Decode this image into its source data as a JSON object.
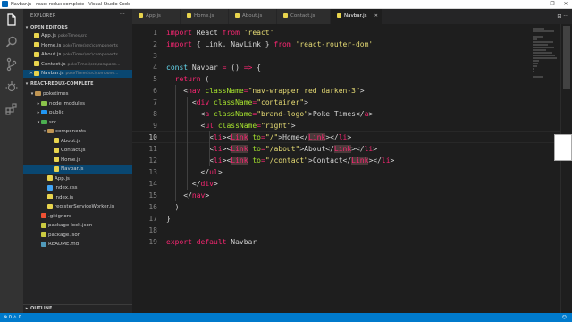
{
  "window": {
    "title": "Navbar.js - react-redux-complete - Visual Studio Code",
    "controls": [
      "—",
      "❐",
      "✕"
    ]
  },
  "activity_bar": {
    "icons": [
      "files-icon",
      "search-icon",
      "source-control-icon",
      "debug-icon",
      "extensions-icon"
    ]
  },
  "sidebar": {
    "header": "EXPLORER",
    "open_editors_label": "OPEN EDITORS",
    "open_editors": [
      {
        "name": "App.js",
        "path": "pokeTimes\\src"
      },
      {
        "name": "Home.js",
        "path": "pokeTimes\\src\\components"
      },
      {
        "name": "About.js",
        "path": "pokeTimes\\src\\components"
      },
      {
        "name": "Contact.js",
        "path": "pokeTimes\\src\\compone..."
      },
      {
        "name": "Navbar.js",
        "path": "pokeTimes\\src\\compone..."
      }
    ],
    "project_label": "REACT-REDUX-COMPLETE",
    "tree": [
      {
        "name": "poketimes",
        "kind": "folder-open"
      },
      {
        "name": "node_modules",
        "kind": "folder"
      },
      {
        "name": "public",
        "kind": "folder"
      },
      {
        "name": "src",
        "kind": "folder-open"
      },
      {
        "name": "components",
        "kind": "folder-open"
      },
      {
        "name": "About.js",
        "kind": "js"
      },
      {
        "name": "Contact.js",
        "kind": "js"
      },
      {
        "name": "Home.js",
        "kind": "js"
      },
      {
        "name": "Navbar.js",
        "kind": "js"
      },
      {
        "name": "App.js",
        "kind": "js"
      },
      {
        "name": "index.css",
        "kind": "css"
      },
      {
        "name": "index.js",
        "kind": "js"
      },
      {
        "name": "registerServiceWorker.js",
        "kind": "js"
      },
      {
        "name": ".gitignore",
        "kind": "git"
      },
      {
        "name": "package-lock.json",
        "kind": "json"
      },
      {
        "name": "package.json",
        "kind": "json"
      },
      {
        "name": "README.md",
        "kind": "md"
      }
    ],
    "outline_label": "OUTLINE"
  },
  "tabs": [
    {
      "label": "App.js",
      "active": false
    },
    {
      "label": "Home.js",
      "active": false
    },
    {
      "label": "About.js",
      "active": false
    },
    {
      "label": "Contact.js",
      "active": false
    },
    {
      "label": "Navbar.js",
      "active": true
    }
  ],
  "tab_actions": "⊟ ···",
  "editor": {
    "current_line": 10,
    "lines": [
      {
        "n": "1",
        "tokens": [
          [
            "k",
            "import"
          ],
          [
            "p",
            " React "
          ],
          [
            "k",
            "from"
          ],
          [
            "p",
            " "
          ],
          [
            "s",
            "'react'"
          ]
        ]
      },
      {
        "n": "2",
        "tokens": [
          [
            "k",
            "import"
          ],
          [
            "p",
            " { Link, NavLink } "
          ],
          [
            "k",
            "from"
          ],
          [
            "p",
            " "
          ],
          [
            "s",
            "'react-router-dom'"
          ]
        ]
      },
      {
        "n": "3",
        "tokens": []
      },
      {
        "n": "4",
        "tokens": [
          [
            "bl",
            "const"
          ],
          [
            "p",
            " Navbar "
          ],
          [
            "k",
            "="
          ],
          [
            "p",
            " () "
          ],
          [
            "k",
            "=>"
          ],
          [
            "p",
            " {"
          ]
        ]
      },
      {
        "n": "5",
        "tokens": [
          [
            "p",
            "  "
          ],
          [
            "k",
            "return"
          ],
          [
            "p",
            " ("
          ]
        ]
      },
      {
        "n": "6",
        "tokens": [
          [
            "p",
            "    <"
          ],
          [
            "t",
            "nav"
          ],
          [
            "p",
            " "
          ],
          [
            "a",
            "className"
          ],
          [
            "k",
            "="
          ],
          [
            "s",
            "\"nav-wrapper red darken-3\""
          ],
          [
            "p",
            ">"
          ]
        ]
      },
      {
        "n": "7",
        "tokens": [
          [
            "p",
            "      <"
          ],
          [
            "t",
            "div"
          ],
          [
            "p",
            " "
          ],
          [
            "a",
            "className"
          ],
          [
            "k",
            "="
          ],
          [
            "s",
            "\"container\""
          ],
          [
            "p",
            ">"
          ]
        ]
      },
      {
        "n": "8",
        "tokens": [
          [
            "p",
            "        <"
          ],
          [
            "t",
            "a"
          ],
          [
            "p",
            " "
          ],
          [
            "a",
            "className"
          ],
          [
            "k",
            "="
          ],
          [
            "s",
            "\"brand-logo\""
          ],
          [
            "p",
            ">Poke'Times</"
          ],
          [
            "t",
            "a"
          ],
          [
            "p",
            ">"
          ]
        ]
      },
      {
        "n": "9",
        "tokens": [
          [
            "p",
            "        <"
          ],
          [
            "t",
            "ul"
          ],
          [
            "p",
            " "
          ],
          [
            "a",
            "className"
          ],
          [
            "k",
            "="
          ],
          [
            "s",
            "\"right\""
          ],
          [
            "p",
            ">"
          ]
        ]
      },
      {
        "n": "10",
        "tokens": [
          [
            "p",
            "          <"
          ],
          [
            "t",
            "li"
          ],
          [
            "p",
            "><"
          ],
          [
            "t",
            "Link"
          ],
          [
            "p",
            " "
          ],
          [
            "a",
            "to"
          ],
          [
            "k",
            "="
          ],
          [
            "s",
            "\"/\""
          ],
          [
            "p",
            ">Home</"
          ],
          [
            "t",
            "Link"
          ],
          [
            "p",
            "></"
          ],
          [
            "t",
            "li"
          ],
          [
            "p",
            ">"
          ]
        ]
      },
      {
        "n": "11",
        "tokens": [
          [
            "p",
            "          <"
          ],
          [
            "t",
            "li"
          ],
          [
            "p",
            "><"
          ],
          [
            "t",
            "Link"
          ],
          [
            "p",
            " "
          ],
          [
            "a",
            "to"
          ],
          [
            "k",
            "="
          ],
          [
            "s",
            "\"/about\""
          ],
          [
            "p",
            ">About</"
          ],
          [
            "t",
            "Link"
          ],
          [
            "p",
            "></"
          ],
          [
            "t",
            "li"
          ],
          [
            "p",
            ">"
          ]
        ]
      },
      {
        "n": "12",
        "tokens": [
          [
            "p",
            "          <"
          ],
          [
            "t",
            "li"
          ],
          [
            "p",
            "><"
          ],
          [
            "t",
            "Link"
          ],
          [
            "p",
            " "
          ],
          [
            "a",
            "to"
          ],
          [
            "k",
            "="
          ],
          [
            "s",
            "\"/contact\""
          ],
          [
            "p",
            ">Contact</"
          ],
          [
            "t",
            "Link"
          ],
          [
            "p",
            "></"
          ],
          [
            "t",
            "li"
          ],
          [
            "p",
            ">"
          ]
        ]
      },
      {
        "n": "13",
        "tokens": [
          [
            "p",
            "        </"
          ],
          [
            "t",
            "ul"
          ],
          [
            "p",
            ">"
          ]
        ]
      },
      {
        "n": "14",
        "tokens": [
          [
            "p",
            "      </"
          ],
          [
            "t",
            "div"
          ],
          [
            "p",
            ">"
          ]
        ]
      },
      {
        "n": "15",
        "tokens": [
          [
            "p",
            "    </"
          ],
          [
            "t",
            "nav"
          ],
          [
            "p",
            ">"
          ]
        ]
      },
      {
        "n": "16",
        "tokens": [
          [
            "p",
            "  )"
          ]
        ]
      },
      {
        "n": "17",
        "tokens": [
          [
            "p",
            "}"
          ]
        ]
      },
      {
        "n": "18",
        "tokens": []
      },
      {
        "n": "19",
        "tokens": [
          [
            "k",
            "export"
          ],
          [
            "p",
            " "
          ],
          [
            "k",
            "default"
          ],
          [
            "p",
            " Navbar"
          ]
        ]
      }
    ]
  },
  "colors": {
    "activity_bar": "#333333",
    "sidebar": "#252526",
    "editor": "#1e1e1e",
    "status_bar": "#007acc",
    "keyword": "#f92672",
    "string": "#e6db74",
    "attribute": "#a6e22e"
  }
}
